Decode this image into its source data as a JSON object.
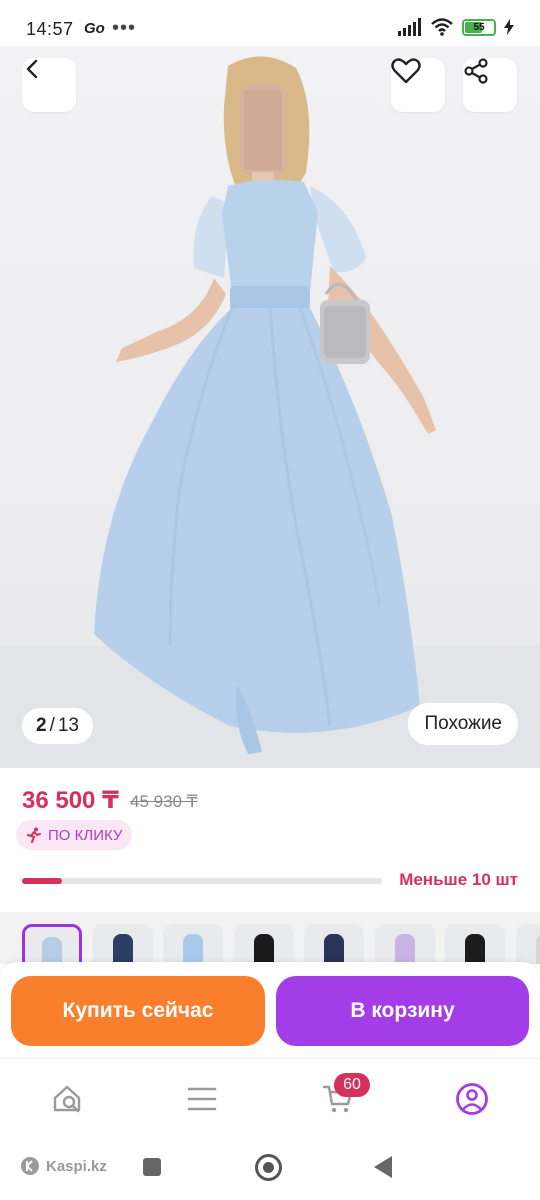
{
  "status_bar": {
    "time": "14:57",
    "go_label": "Go",
    "more": "•••",
    "battery": "55"
  },
  "gallery": {
    "current": "2",
    "separator": "/",
    "total": "13",
    "similar_label": "Похожие",
    "image_description": "light-blue maxi-dress-photo"
  },
  "product": {
    "price": "36 500 ₸",
    "old_price": "45 930 ₸",
    "badge_label": "ПО КЛИКУ",
    "stock_label": "Меньше 10 шт",
    "stock_level": 0.11
  },
  "thumbnails": [
    {
      "color": "#b7cde6",
      "active": true
    },
    {
      "color": "#2d3e66",
      "active": false
    },
    {
      "color": "#a9c9ec",
      "active": false
    },
    {
      "color": "#1a1a1a",
      "active": false
    },
    {
      "color": "#2a3358",
      "active": false
    },
    {
      "color": "#c9b3e3",
      "active": false
    },
    {
      "color": "#1c1c1c",
      "active": false
    },
    {
      "color": "#d9d6cf",
      "active": false
    }
  ],
  "actions": {
    "buy_now": "Купить сейчас",
    "add_to_cart": "В корзину"
  },
  "bottom_nav": {
    "cart_count": "60",
    "items": [
      "search-icon",
      "menu-icon",
      "cart-icon",
      "profile-icon"
    ]
  },
  "system_nav": {
    "brand": "Kaspi.kz"
  },
  "colors": {
    "accent_red": "#d6305c",
    "buy_orange": "#f97f2c",
    "cart_purple": "#a23de8",
    "badge_bg": "#fbe6f5"
  }
}
